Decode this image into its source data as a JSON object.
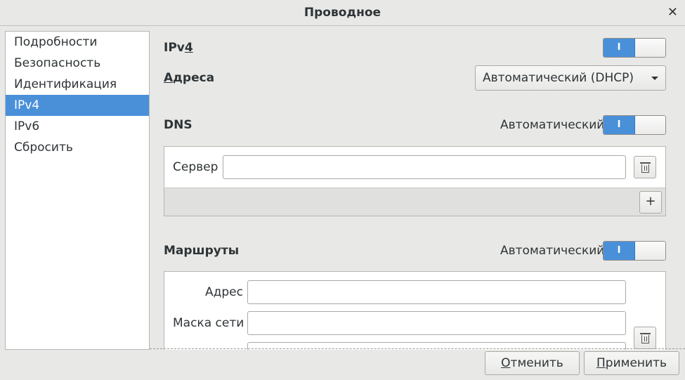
{
  "window": {
    "title": "Проводное"
  },
  "sidebar": {
    "items": [
      {
        "label": "Подробности"
      },
      {
        "label": "Безопасность"
      },
      {
        "label": "Идентификация"
      },
      {
        "label": "IPv4",
        "selected": true
      },
      {
        "label": "IPv6"
      },
      {
        "label": "Сбросить"
      }
    ]
  },
  "ipv4": {
    "label_start": "IPv",
    "label_mnemonic": "4",
    "switch": {
      "on_label": "I",
      "state": "on"
    }
  },
  "addresses": {
    "label": "Адреса",
    "method_selected": "Автоматический (DHCP)"
  },
  "dns": {
    "label": "DNS",
    "auto_label": "Автоматический",
    "switch": {
      "on_label": "I",
      "state": "on"
    },
    "server_label": "Сервер",
    "server_value": "",
    "add_label": "+"
  },
  "routes": {
    "label": "Маршруты",
    "auto_label": "Автоматический",
    "switch": {
      "on_label": "I",
      "state": "on"
    },
    "address_label": "Адрес",
    "address_value": "",
    "netmask_label": "Маска сети",
    "netmask_value": "",
    "gateway_value": ""
  },
  "footer": {
    "cancel_label": "Отменить",
    "apply_label": "Применить"
  },
  "colors": {
    "accent": "#4a90d9",
    "background": "#e8e8e7"
  }
}
